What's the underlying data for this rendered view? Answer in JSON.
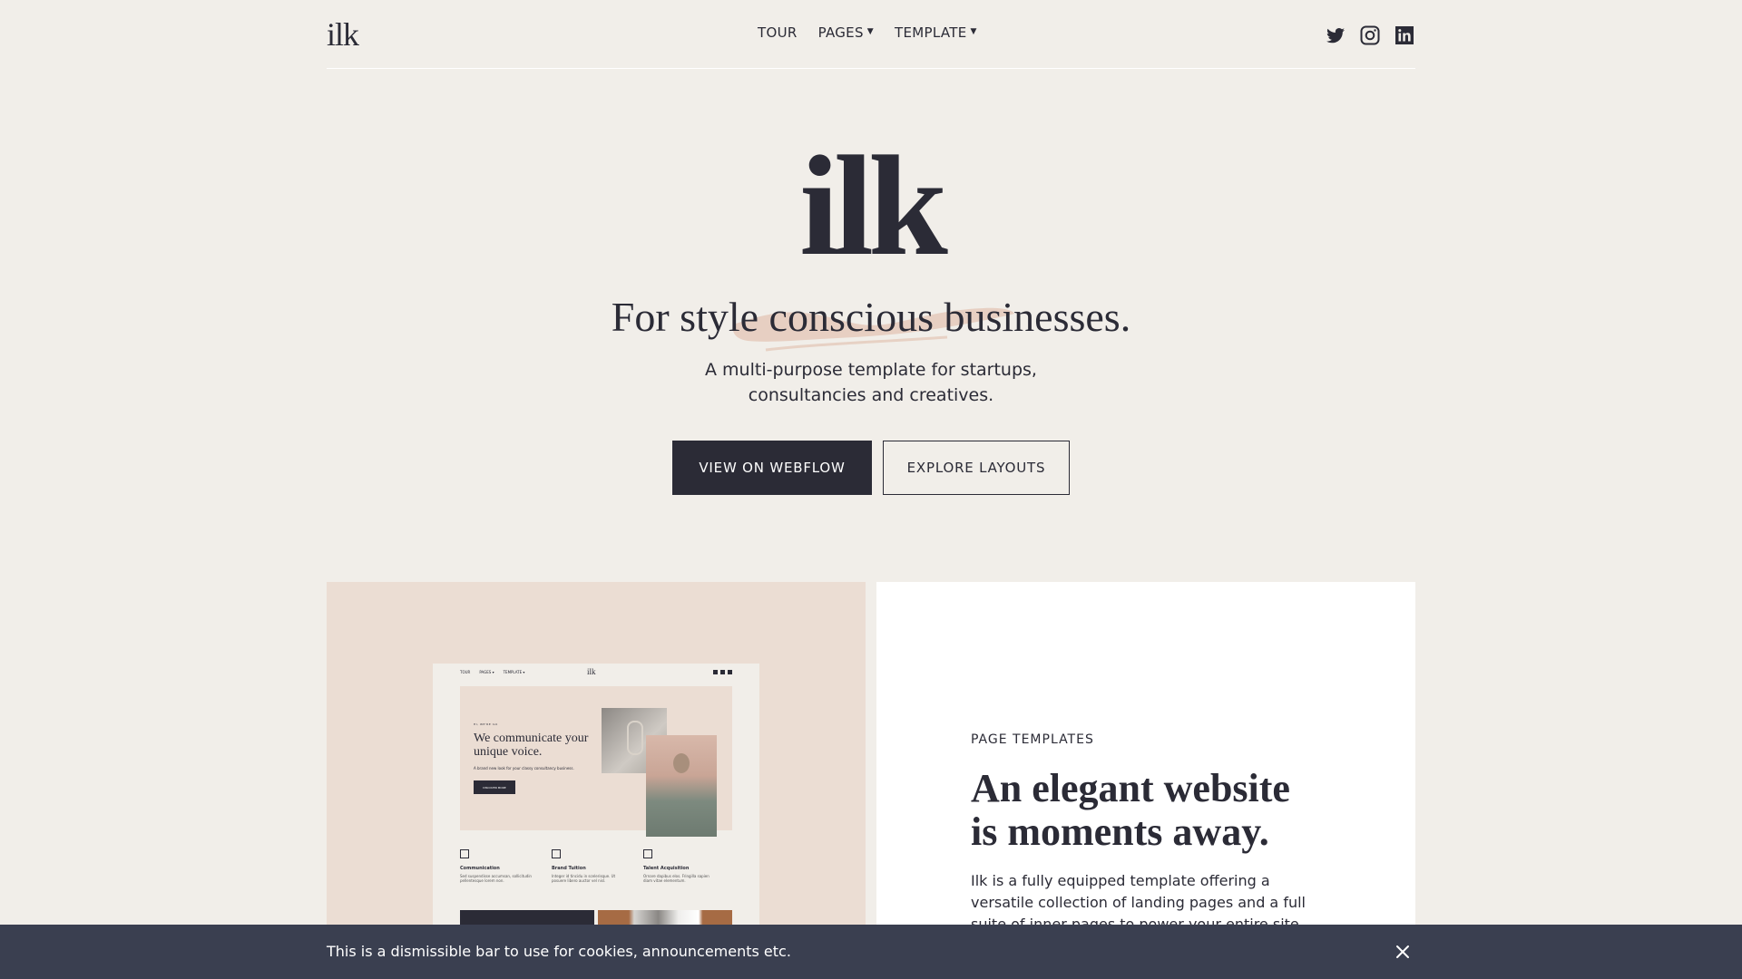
{
  "header": {
    "logo": "ilk",
    "nav": [
      {
        "label": "TOUR",
        "has_caret": false
      },
      {
        "label": "PAGES",
        "has_caret": true
      },
      {
        "label": "TEMPLATE",
        "has_caret": true
      }
    ],
    "social_icons": [
      "twitter-icon",
      "instagram-icon",
      "linkedin-icon"
    ]
  },
  "hero": {
    "logo": "ilk",
    "tagline": "For style conscious businesses.",
    "subtitle_line1": "A multi-purpose template for startups,",
    "subtitle_line2": "consultancies and creatives.",
    "primary_button": "VIEW ON WEBFLOW",
    "secondary_button": "EXPLORE LAYOUTS"
  },
  "preview": {
    "nav": [
      "TOUR",
      "PAGES ▾",
      "TEMPLATE ▾"
    ],
    "logo": "ilk",
    "eyebrow": "HI, WE'RE ILK",
    "headline": "We communicate your unique voice.",
    "description": "A brand new look for your classy consultancy business.",
    "button": "DISCOVER MORE",
    "features": [
      {
        "title": "Communication",
        "text": "Sed suspendisse accumsan, sollicitudin pellentesque lorem non."
      },
      {
        "title": "Brand Tuition",
        "text": "Integer id tincidu in scelerisque. Ut posuere libero auctor vel nisl."
      },
      {
        "title": "Talent Acquisition",
        "text": "Ornare dapibus elos. Fringilla sapien diam vitae elementum."
      }
    ]
  },
  "feature_card": {
    "eyebrow": "PAGE TEMPLATES",
    "title_line1": "An elegant website",
    "title_line2": "is moments away.",
    "body": "Ilk is a fully equipped template offering a versatile collection of landing pages and a full suite of inner pages to power your entire site."
  },
  "cookie_bar": {
    "text": "This is a dismissible bar to use for cookies, announcements etc.",
    "close_icon": "close-icon"
  },
  "colors": {
    "background": "#f1eee9",
    "ink": "#2b2b36",
    "blush": "#ebddd3",
    "brush": "#e3c4b4",
    "cookie_bar": "#3a3f50"
  }
}
